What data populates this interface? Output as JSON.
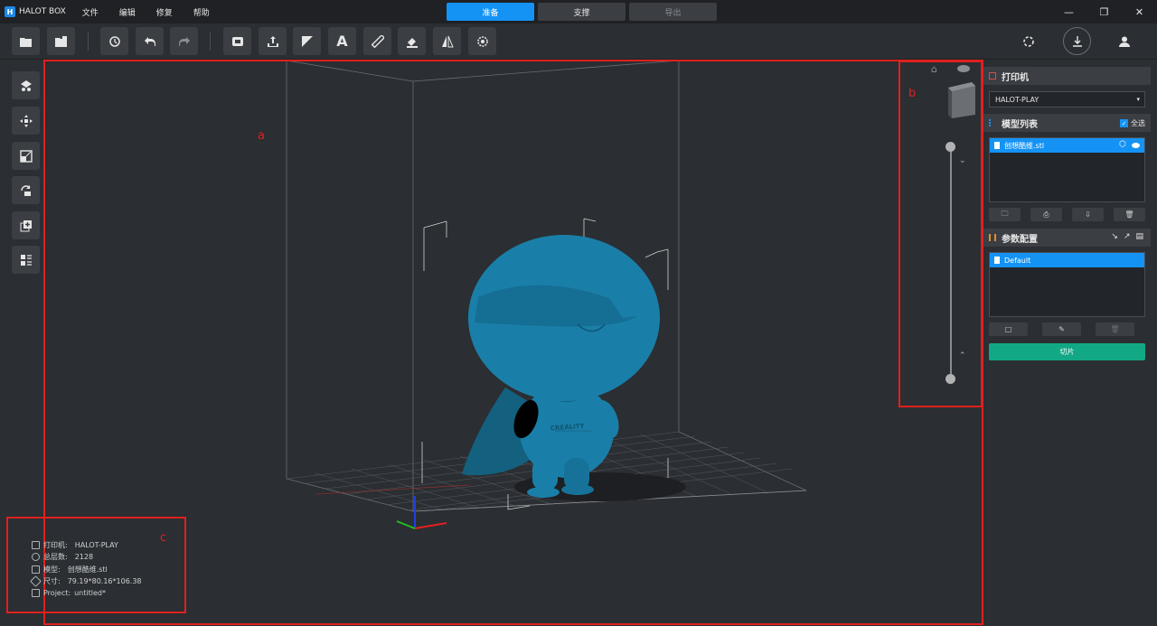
{
  "titlebar": {
    "app_name": "HALOT BOX",
    "menu": [
      "文件",
      "编辑",
      "修复",
      "帮助"
    ],
    "tabs": [
      "准备",
      "支撑",
      "导出"
    ]
  },
  "viewport": {
    "annotations": {
      "a": "a",
      "b": "b",
      "c": "c"
    },
    "model_logo": "CREALITY"
  },
  "right_panel": {
    "printer": {
      "title": "打印机",
      "selected": "HALOT-PLAY"
    },
    "model_list": {
      "title": "模型列表",
      "select_all": "全选",
      "items": [
        "创想酷维.stl"
      ]
    },
    "param_config": {
      "title": "参数配置",
      "items": [
        "Default"
      ]
    },
    "slice_label": "切片"
  },
  "info": {
    "printer_key": "打印机:",
    "printer_val": "HALOT-PLAY",
    "layers_key": "总层数:",
    "layers_val": "2128",
    "model_key": "模型:",
    "model_val": "创想酷维.stl",
    "size_key": "尺寸:",
    "size_val": "79.19*80.16*106.38",
    "project_key": "Project:",
    "project_val": "untitled*"
  },
  "colors": {
    "accent": "#1593f5",
    "slice": "#12a886",
    "annotation": "#e02020",
    "model": "#1a7fa8"
  }
}
